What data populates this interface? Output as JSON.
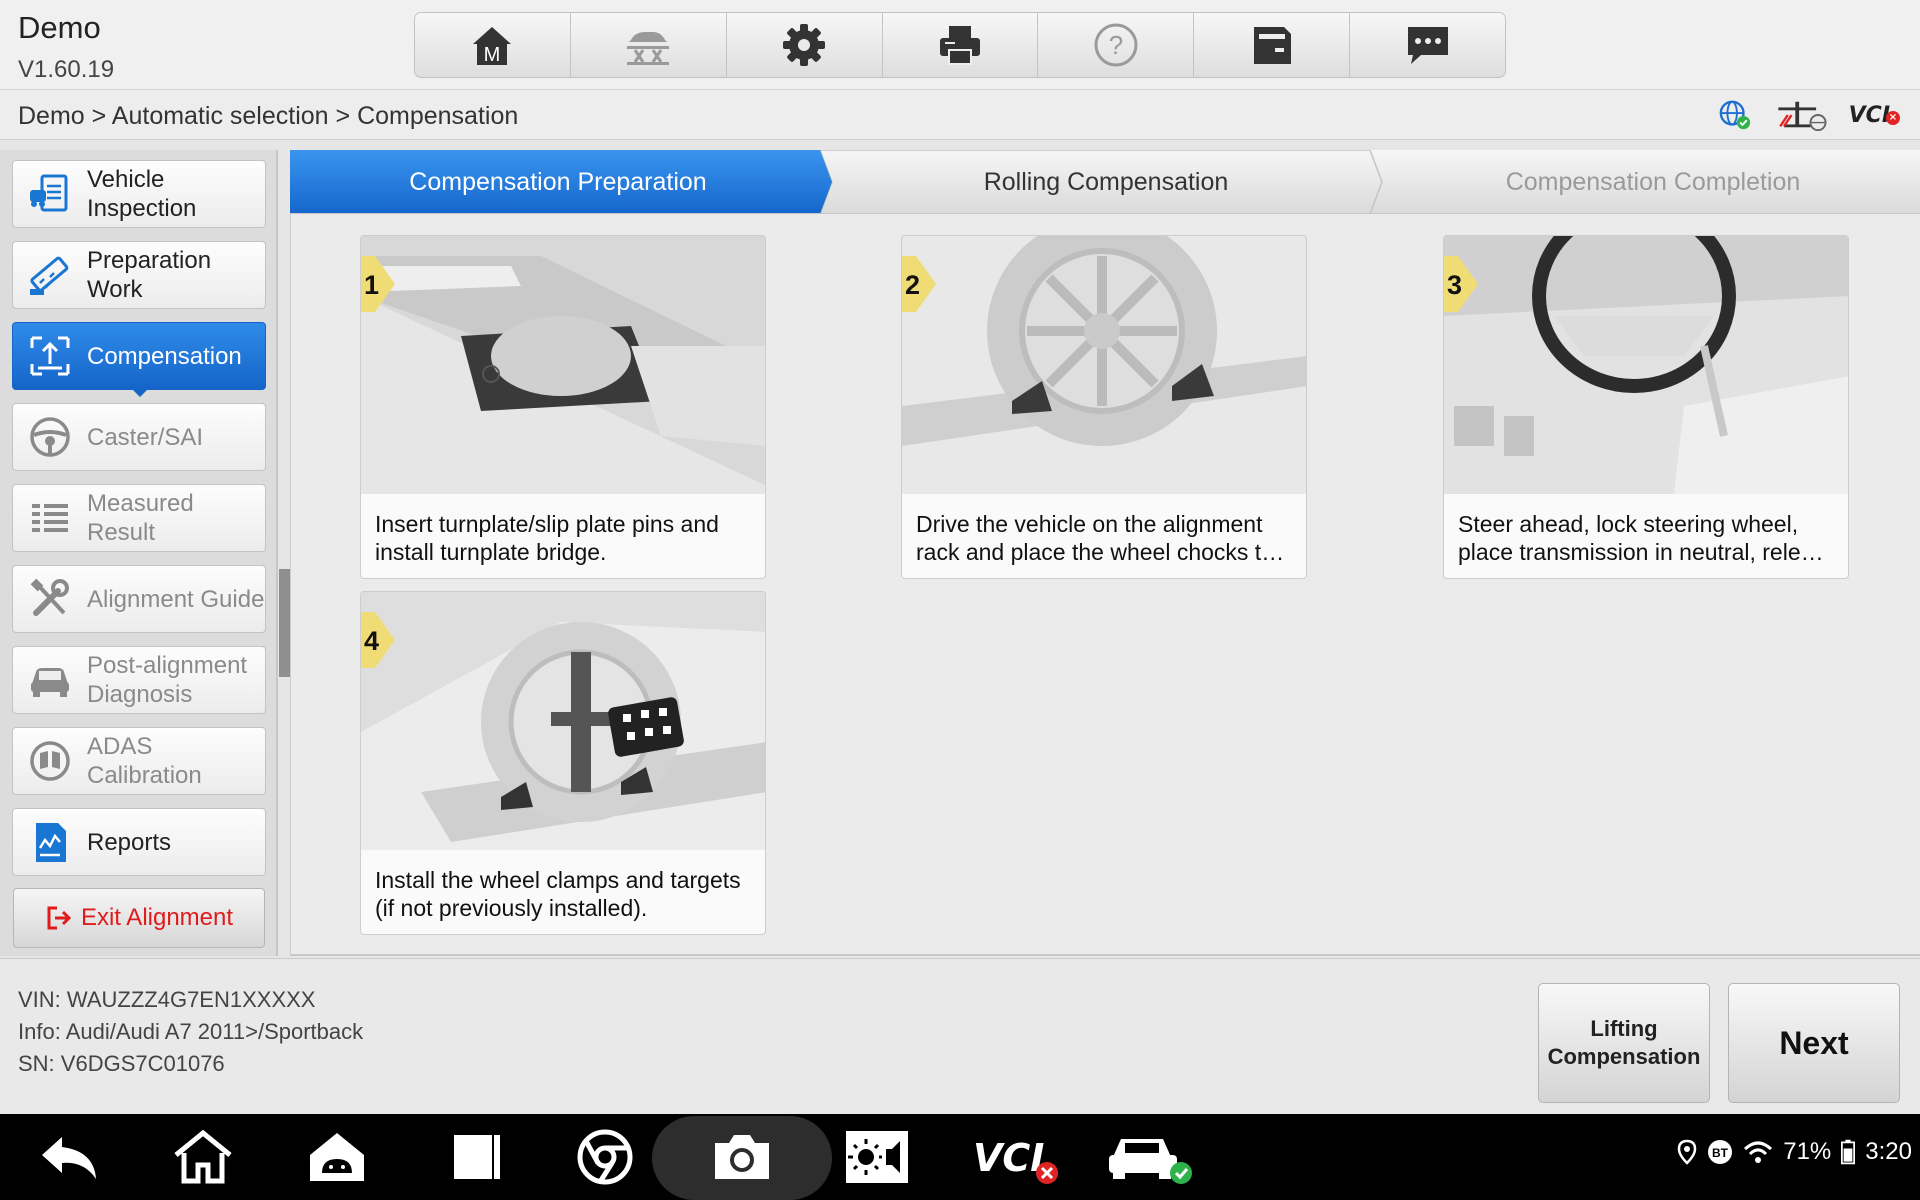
{
  "header": {
    "title": "Demo",
    "version": "V1.60.19",
    "toolbar": [
      "home-icon",
      "lift-icon",
      "settings-icon",
      "print-icon",
      "help-icon",
      "save-icon",
      "message-icon"
    ]
  },
  "breadcrumb": "Demo > Automatic selection > Compensation",
  "status": {
    "vci_label": "VCI"
  },
  "sidebar": {
    "items": [
      {
        "label": "Vehicle Inspection",
        "icon": "vehicle-inspection-icon"
      },
      {
        "label": "Preparation Work",
        "icon": "preparation-icon"
      },
      {
        "label": "Compensation",
        "icon": "compensation-icon",
        "active": true
      },
      {
        "label": "Caster/SAI",
        "icon": "steering-wheel-icon"
      },
      {
        "label": "Measured Result",
        "icon": "list-icon"
      },
      {
        "label": "Alignment Guide",
        "icon": "tools-icon"
      },
      {
        "label": "Post-alignment Diagnosis",
        "icon": "car-icon"
      },
      {
        "label": "ADAS Calibration",
        "icon": "adas-icon"
      },
      {
        "label": "Reports",
        "icon": "report-icon"
      }
    ],
    "exit_label": "Exit Alignment"
  },
  "steps": [
    {
      "label": "Compensation Preparation",
      "state": "active"
    },
    {
      "label": "Rolling Compensation",
      "state": "pending"
    },
    {
      "label": "Compensation Completion",
      "state": "disabled"
    }
  ],
  "cards": [
    {
      "number": "1",
      "caption": "Insert turnplate/slip plate pins and install turnplate bridge."
    },
    {
      "number": "2",
      "caption": "Drive the vehicle on the alignment rack and place the wheel chocks t…"
    },
    {
      "number": "3",
      "caption": "Steer ahead, lock steering wheel, place transmission in neutral, rele…"
    },
    {
      "number": "4",
      "caption": "Install the wheel clamps and targets (if not previously installed)."
    }
  ],
  "info": {
    "vin": "VIN: WAUZZZ4G7EN1XXXXX",
    "vehicle": "Info: Audi/Audi A7 2011>/Sportback",
    "sn": "SN: V6DGS7C01076"
  },
  "buttons": {
    "lifting": "Lifting Compensation",
    "next": "Next"
  },
  "system": {
    "battery": "71%",
    "time": "3:20",
    "bt": "BT"
  },
  "colors": {
    "accent": "#1976d2",
    "exit": "#e01b1b"
  }
}
